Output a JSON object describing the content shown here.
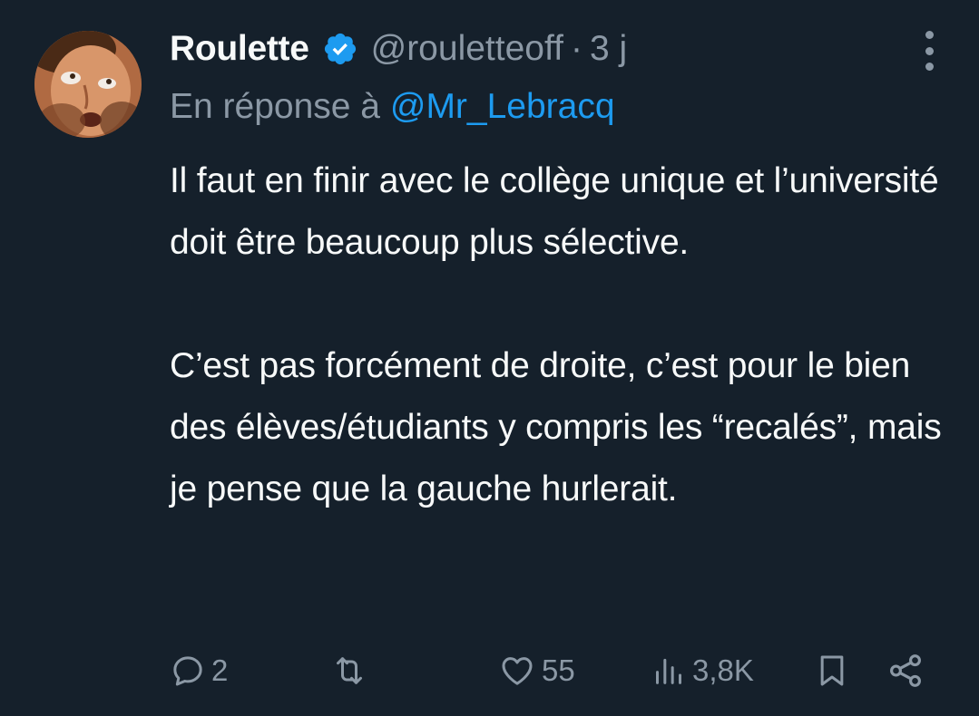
{
  "tweet": {
    "author": {
      "name": "Roulette",
      "handle": "@rouletteoff",
      "verified": true,
      "avatar_icon": "avatar-image"
    },
    "separator": "·",
    "time": "3 j",
    "replying_prefix": "En réponse à",
    "replying_to": "@Mr_Lebracq",
    "paragraphs": [
      "Il faut en finir avec le collège unique et l’université doit être beaucoup plus sélective.",
      "C’est pas forcément de droite, c’est pour le bien des élèves/étudiants y compris les “recalés”, mais je pense que la gauche hurlerait."
    ],
    "stats": {
      "replies": "2",
      "retweets": "",
      "likes": "55",
      "views": "3,8K"
    },
    "colors": {
      "background": "#15202b",
      "text": "#f7f9f9",
      "muted": "#8b98a5",
      "accent": "#1d9bf0"
    }
  }
}
